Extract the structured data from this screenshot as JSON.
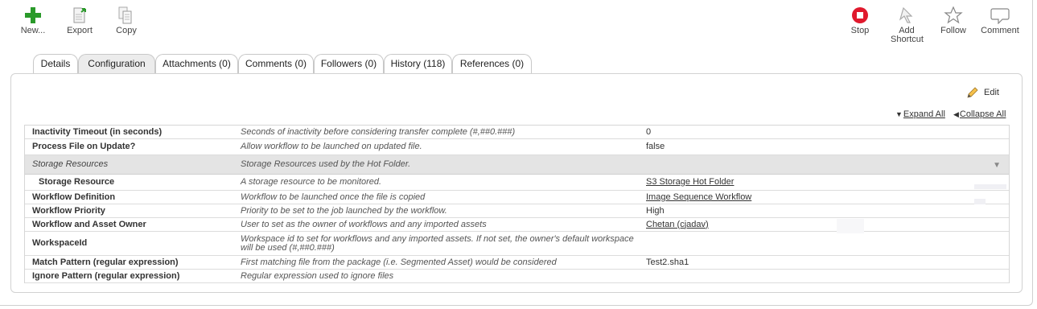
{
  "toolbar": {
    "new_label": "New...",
    "export_label": "Export",
    "copy_label": "Copy",
    "stop_label": "Stop",
    "add_shortcut_label": "Add Shortcut",
    "follow_label": "Follow",
    "comment_label": "Comment"
  },
  "tabs": [
    {
      "label": "Details",
      "active": false
    },
    {
      "label": "Configuration",
      "active": true
    },
    {
      "label": "Attachments (0)",
      "active": false
    },
    {
      "label": "Comments (0)",
      "active": false
    },
    {
      "label": "Followers (0)",
      "active": false
    },
    {
      "label": "History (118)",
      "active": false
    },
    {
      "label": "References (0)",
      "active": false
    }
  ],
  "panel": {
    "edit_label": "Edit",
    "expand_all": "Expand All",
    "collapse_all": "Collapse All"
  },
  "rows": {
    "inactivity": {
      "name": "Inactivity Timeout (in seconds)",
      "desc": "Seconds of inactivity before considering transfer complete (#,##0.###)",
      "value": "0"
    },
    "process_file": {
      "name": "Process File on Update?",
      "desc": "Allow workflow to be launched on updated file.",
      "value": "false"
    },
    "storage_group": {
      "name": "Storage Resources",
      "desc": "Storage Resources used by the Hot Folder."
    },
    "storage_resource": {
      "name": "Storage Resource",
      "desc": "A storage resource to be monitored.",
      "value": "S3 Storage Hot Folder"
    },
    "workflow_def": {
      "name": "Workflow Definition",
      "desc": "Workflow to be launched once the file is copied",
      "value": "Image Sequence Workflow"
    },
    "workflow_priority": {
      "name": "Workflow Priority",
      "desc": "Priority to be set to the job launched by the workflow.",
      "value": "High"
    },
    "workflow_owner": {
      "name": "Workflow and Asset Owner",
      "desc": "User to set as the owner of workflows and any imported assets",
      "value": "Chetan (cjadav)"
    },
    "workspace_id": {
      "name": "WorkspaceId",
      "desc": "Workspace id to set for workflows and any imported assets. If not set, the owner's default workspace will be used (#,##0.###)",
      "value": ""
    },
    "match_pattern": {
      "name": "Match Pattern (regular expression)",
      "desc": "First matching file from the package (i.e. Segmented Asset) would be considered",
      "value": "Test2.sha1"
    },
    "ignore_pattern": {
      "name": "Ignore Pattern (regular expression)",
      "desc": "Regular expression used to ignore files",
      "value": ""
    }
  },
  "colors": {
    "new_icon": "#2a9a2a",
    "stop_icon": "#e0192d",
    "tab_active": "#ececec",
    "group_row": "#e4e4e4"
  }
}
